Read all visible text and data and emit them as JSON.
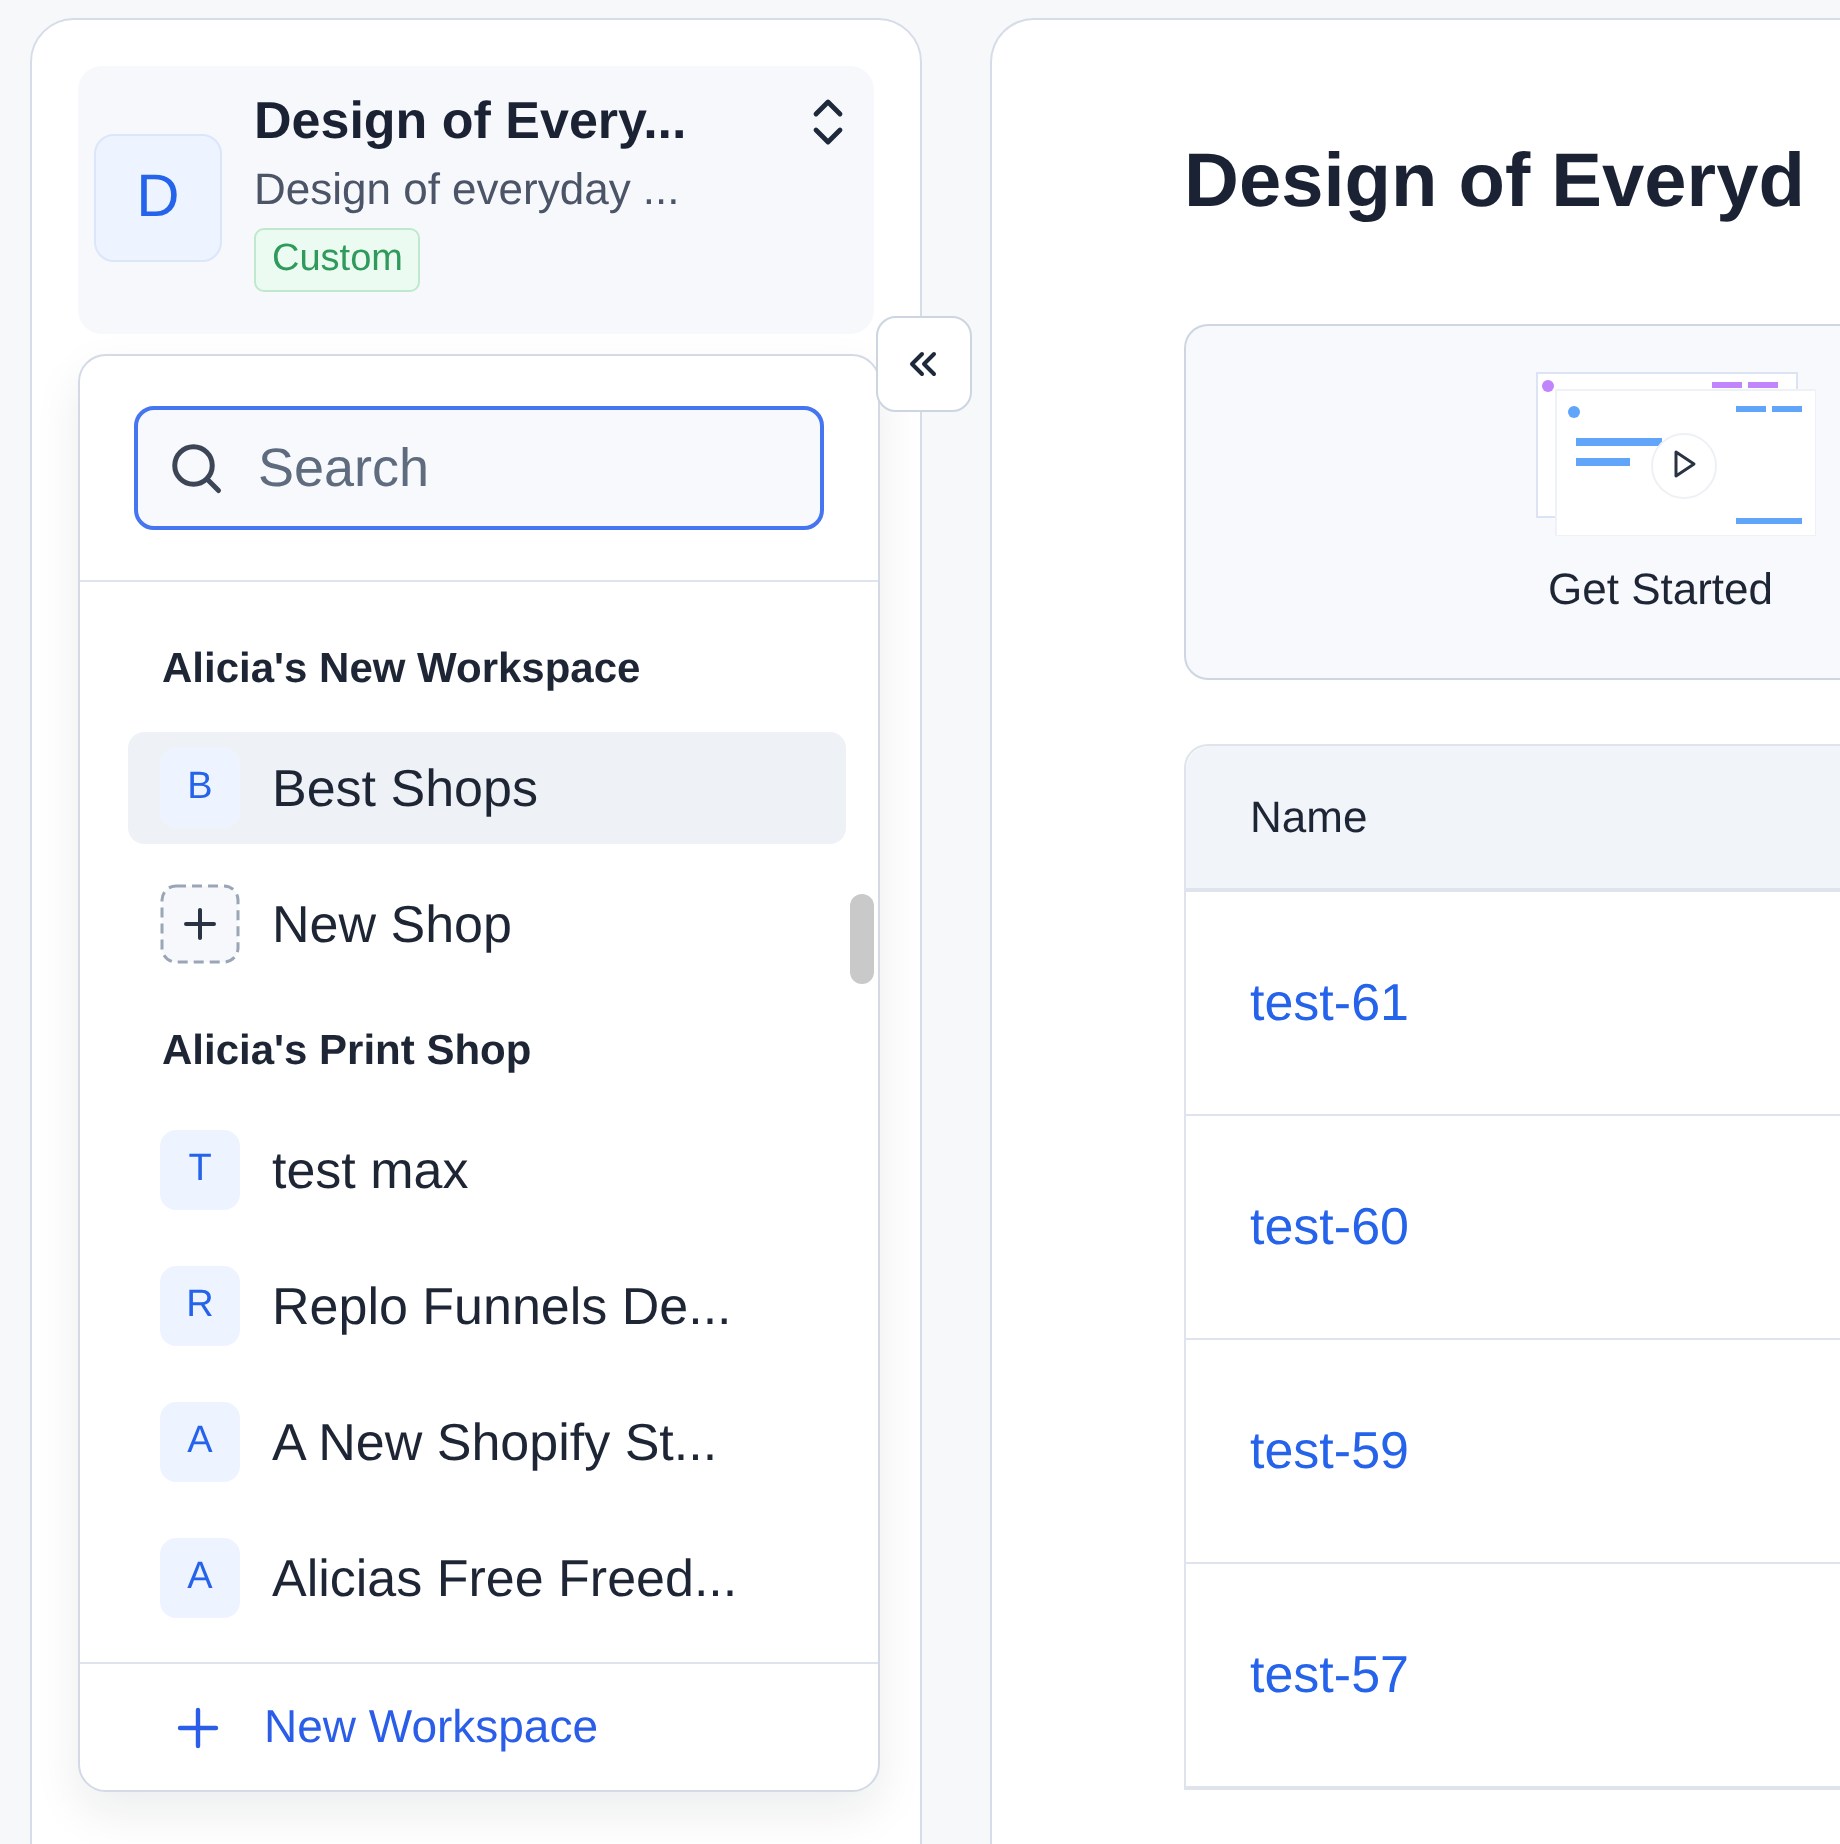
{
  "workspace": {
    "avatar": "D",
    "title": "Design of Every...",
    "subtitle": "Design of everyday ...",
    "badge": "Custom"
  },
  "search": {
    "placeholder": "Search",
    "focused": true
  },
  "groups": [
    {
      "name": "Alicia's New Workspace",
      "items": [
        {
          "kind": "shop",
          "avatar": "B",
          "label": "Best Shops",
          "selected": true
        },
        {
          "kind": "add",
          "label": "New Shop",
          "selected": false
        }
      ]
    },
    {
      "name": "Alicia's Print Shop",
      "items": [
        {
          "kind": "shop",
          "avatar": "T",
          "label": "test max",
          "selected": false
        },
        {
          "kind": "shop",
          "avatar": "R",
          "label": "Replo Funnels De...",
          "selected": false
        },
        {
          "kind": "shop",
          "avatar": "A",
          "label": "A New Shopify St...",
          "selected": false
        },
        {
          "kind": "shop",
          "avatar": "A",
          "label": "Alicias Free Freed...",
          "selected": false
        }
      ]
    }
  ],
  "footer": {
    "label": "New Workspace"
  },
  "main": {
    "title": "Design of Everyd",
    "get_started": "Get Started",
    "table": {
      "columns": [
        "Name"
      ],
      "rows": [
        [
          "test-61"
        ],
        [
          "test-60"
        ],
        [
          "test-59"
        ],
        [
          "test-57"
        ]
      ]
    }
  }
}
